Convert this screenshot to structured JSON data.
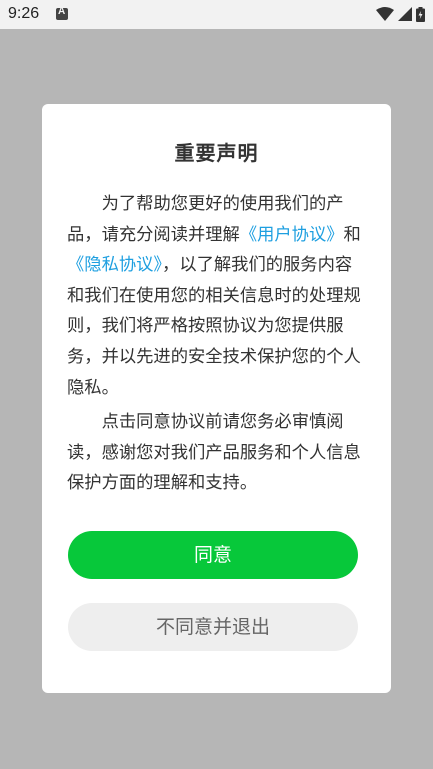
{
  "status_bar": {
    "time": "9:26"
  },
  "dialog": {
    "title": "重要声明",
    "para1_a": "为了帮助您更好的使用我们的产品，请充分阅读并理解",
    "link_user": "《用户协议》",
    "para1_b": "和",
    "link_privacy": "《隐私协议》",
    "para1_c": "，以了解我们的服务内容和我们在使用您的相关信息时的处理规则，我们将严格按照协议为您提供服务，并以先进的安全技术保护您的个人隐私。",
    "para2": "点击同意协议前请您务必审慎阅读，感谢您对我们产品服务和个人信息保护方面的理解和支持。",
    "agree_label": "同意",
    "disagree_label": "不同意并退出"
  },
  "colors": {
    "accent_green": "#07c83a",
    "link_blue": "#1e9fe0",
    "overlay_gray": "#b6b6b6"
  }
}
